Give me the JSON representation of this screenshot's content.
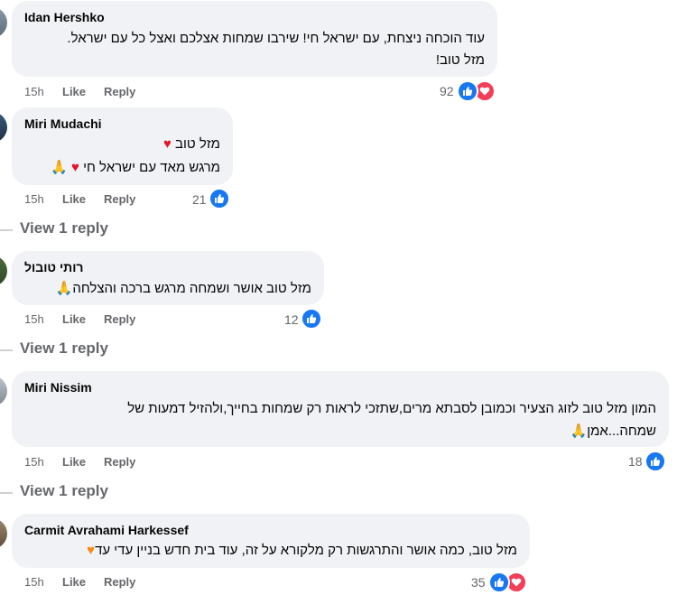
{
  "comments": [
    {
      "author": "Idan Hershko",
      "lines": [
        "עוד הוכחה ניצחת, עם ישראל חי! שירבו שמחות אצלכם ואצל כל עם ישראל.",
        "מזל טוב!"
      ],
      "time": "15h",
      "like": "Like",
      "reply": "Reply",
      "count": "92",
      "reactions": [
        "like-icon",
        "love-icon"
      ]
    },
    {
      "author": "Miri Mudachi",
      "lines": [
        "מזל טוב ",
        "מרגש מאד עם ישראל חי "
      ],
      "emojis": [
        "red-heart",
        "red-heart",
        "folded-hands"
      ],
      "time": "15h",
      "like": "Like",
      "reply": "Reply",
      "count": "21",
      "reactions": [
        "like-icon"
      ],
      "view_reply": "View 1 reply"
    },
    {
      "author": "רותי טובול",
      "lines": [
        "מזל טוב אושר ושמחה מרגש ברכה והצלחה"
      ],
      "emojis": [
        "folded-hands"
      ],
      "time": "15h",
      "like": "Like",
      "reply": "Reply",
      "count": "12",
      "reactions": [
        "like-icon"
      ],
      "view_reply": "View 1 reply"
    },
    {
      "author": "Miri Nissim",
      "lines": [
        "המון מזל טוב לזוג הצעיר וכמובן לסבתא מרים,שתזכי לראות רק שמחות בחייך,ולהזיל דמעות של",
        "שמחה...אמן"
      ],
      "emojis": [
        "folded-hands"
      ],
      "time": "15h",
      "like": "Like",
      "reply": "Reply",
      "count": "18",
      "reactions": [
        "like-icon"
      ],
      "view_reply": "View 1 reply"
    },
    {
      "author": "Carmit Avrahami Harkessef",
      "lines": [
        "מזל טוב, כמה אושר והתרגשות רק מלקורא על זה, עוד בית חדש בניין עדי עד"
      ],
      "emojis": [
        "orange-heart"
      ],
      "time": "15h",
      "like": "Like",
      "reply": "Reply",
      "count": "35",
      "reactions": [
        "like-icon",
        "love-icon"
      ]
    }
  ],
  "colors": {
    "bubble_bg": "#f0f2f5",
    "meta_text": "#65676b",
    "like_blue": "#1877f2",
    "love_red": "#f33e58"
  }
}
